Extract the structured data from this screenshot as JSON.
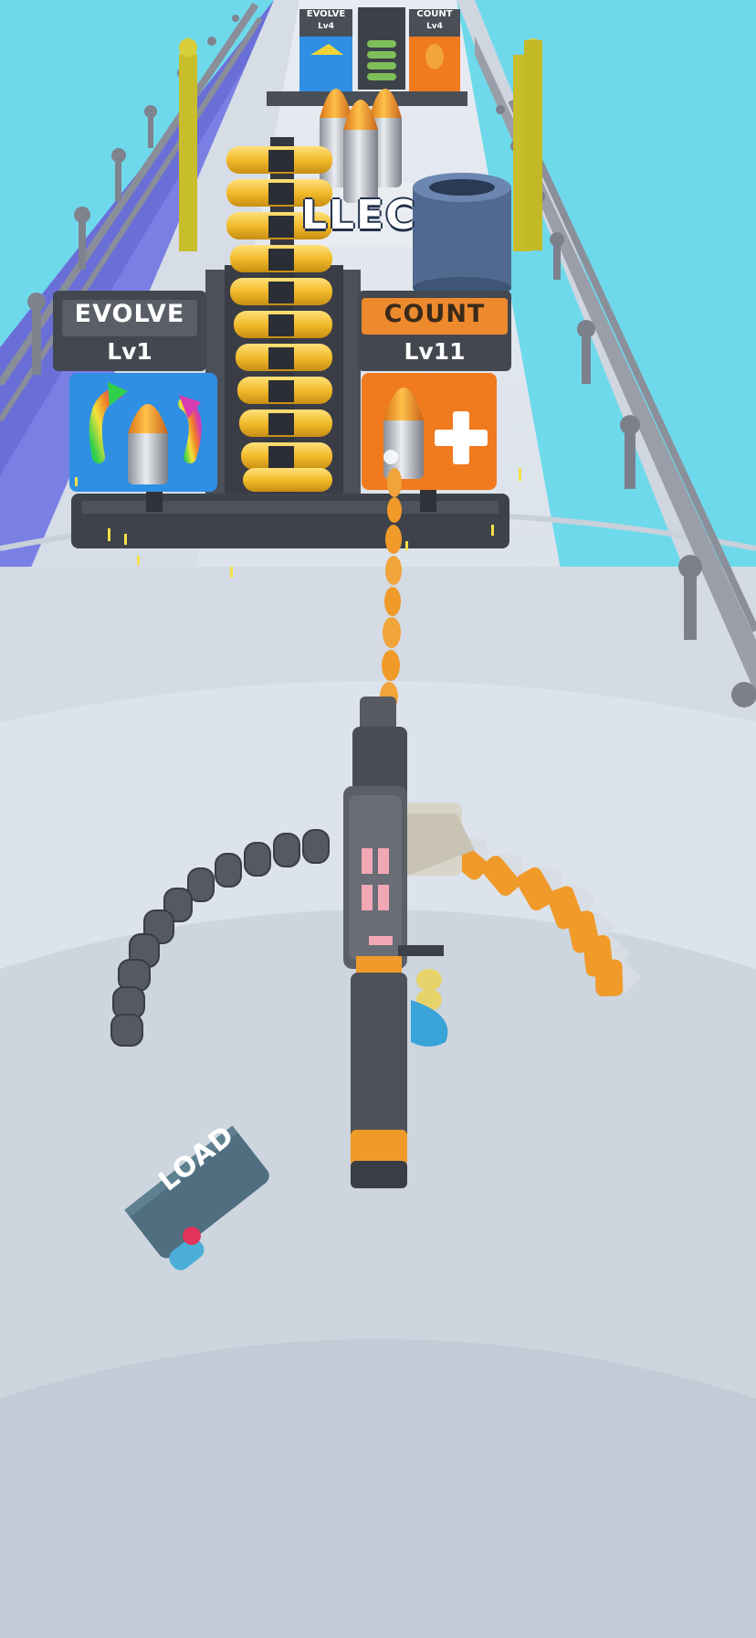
{
  "gates": {
    "near_left": {
      "title": "EVOLVE",
      "level": "Lv1"
    },
    "near_right": {
      "title": "COUNT",
      "level": "Lv11"
    },
    "far_left": {
      "title": "EVOLVE",
      "level": "Lv4"
    },
    "far_right": {
      "title": "COUNT",
      "level": "Lv4"
    }
  },
  "banner": {
    "text": "LLEC"
  },
  "load_pad": {
    "label": "LOAD"
  },
  "colors": {
    "sky": "#6fd9ec",
    "track": "#dfe5ee",
    "evolve_panel": "#2f8fe3",
    "count_panel": "#f07a1e",
    "bullet_gold": "#f3c43a",
    "bullet_orange": "#f09a2a"
  },
  "icons": {
    "evolve": "bullet-with-rainbow-arrows-icon",
    "count": "bullet-plus-icon"
  }
}
